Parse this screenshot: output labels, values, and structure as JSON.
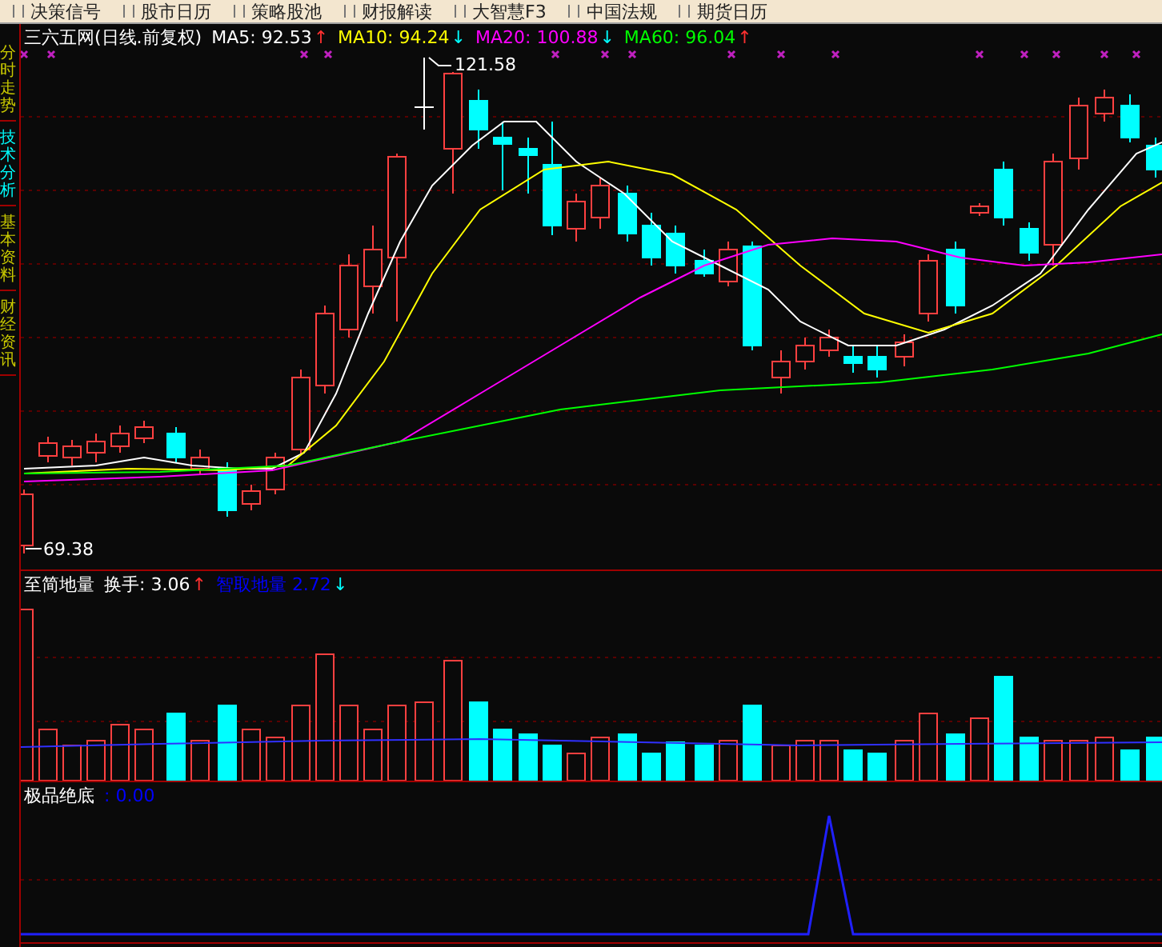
{
  "menu": [
    {
      "label": "决策信号"
    },
    {
      "label": "股市日历"
    },
    {
      "label": "策略股池"
    },
    {
      "label": "财报解读"
    },
    {
      "label": "大智慧F3"
    },
    {
      "label": "中国法规"
    },
    {
      "label": "期货日历"
    }
  ],
  "sidebar": {
    "tabs": [
      {
        "label": "分时走势",
        "selected": false
      },
      {
        "label": "技术分析",
        "selected": true
      },
      {
        "label": "基本资料",
        "selected": false
      },
      {
        "label": "财经资讯",
        "selected": false
      }
    ]
  },
  "main_chart": {
    "title": "三六五网(日线.前复权)",
    "indicators": [
      {
        "name": "MA5:",
        "value": "92.53",
        "rising": true,
        "arrow": "↑",
        "color": "#ffffff"
      },
      {
        "name": "MA10:",
        "value": "94.24",
        "rising": false,
        "arrow": "↓",
        "color": "#ffff00"
      },
      {
        "name": "MA20:",
        "value": "100.88",
        "rising": false,
        "arrow": "↓",
        "color": "#ff00ff"
      },
      {
        "name": "MA60:",
        "value": "96.04",
        "rising": true,
        "arrow": "↑",
        "color": "#00ff00"
      }
    ],
    "high_label": "121.58",
    "low_label": "69.38"
  },
  "volume_panel": {
    "title": "至简地量",
    "indicators": [
      {
        "name": "换手:",
        "value": "3.06",
        "rising": true,
        "arrow": "↑",
        "color": "#ffffff"
      },
      {
        "name": "智取地量",
        "value": "2.72",
        "rising": false,
        "arrow": "↓",
        "color": "#0000ff"
      }
    ]
  },
  "bottom_panel": {
    "title": "极品绝底",
    "value": ": 0.00"
  }
}
